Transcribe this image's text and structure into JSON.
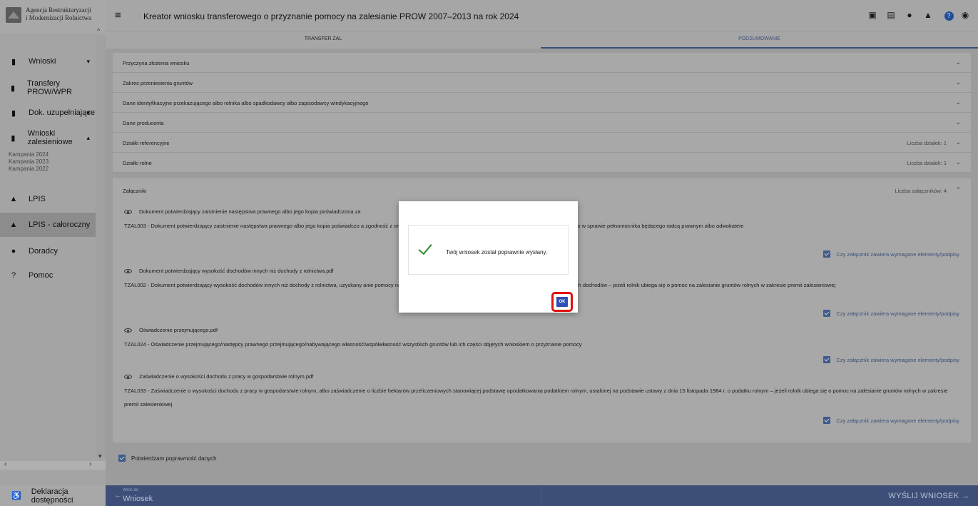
{
  "logo": {
    "line1": "Agencja Restrukturyzacji",
    "line2": "i Modernizacji Rolnictwa"
  },
  "sidebar": {
    "items": [
      {
        "label": "Wnioski",
        "icon": "clipboard-icon",
        "chevron": "down"
      },
      {
        "label": "Transfery PROW/WPR",
        "icon": "clipboard-icon"
      },
      {
        "label": "Dok. uzupełniające",
        "icon": "clipboard-icon",
        "chevron": "down"
      },
      {
        "label": "Wnioski zalesieniowe",
        "icon": "clipboard-icon",
        "chevron": "up"
      },
      {
        "label": "LPIS",
        "icon": "mountain-icon"
      },
      {
        "label": "LPIS - całoroczny",
        "icon": "mountain-icon",
        "active": true
      },
      {
        "label": "Doradcy",
        "icon": "person-icon"
      },
      {
        "label": "Pomoc",
        "icon": "help-icon"
      }
    ],
    "campaigns": [
      "Kampania 2024",
      "Kampania 2023",
      "Kampania 2022"
    ],
    "footer": "Deklaracja dostępności"
  },
  "header": {
    "title": "Kreator wniosku transferowego o przyznanie pomocy na zalesianie PROW 2007–2013 na rok 2024",
    "icons": [
      "save-icon",
      "print-icon",
      "alert-icon",
      "bell-icon",
      "help-icon",
      "account-icon"
    ]
  },
  "tabs": [
    {
      "label": "TRANSFER ZAL"
    },
    {
      "label": "PODSUMOWANIE",
      "active": true
    }
  ],
  "sections": [
    {
      "label": "Przyczyna złożenia wniosku",
      "right": ""
    },
    {
      "label": "Zakres przeniesienia gruntów",
      "right": ""
    },
    {
      "label": "Dane identyfikacyjne przekazującego albo rolnika albo spadkodawcy albo zapisodawcy windykacyjnego",
      "right": ""
    },
    {
      "label": "Dane producenta",
      "right": ""
    },
    {
      "label": "Działki referencyjne",
      "right": "Liczba działek: 1"
    },
    {
      "label": "Działki rolne",
      "right": "Liczba działek: 1"
    }
  ],
  "attachments": {
    "title": "Załączniki",
    "count_label": "Liczba załączników: 4",
    "check_label": "Czy załącznik zawiera wymagane elementy/podpisy",
    "items": [
      {
        "name": "Dokument potwierdzający zaistnienie następstwa prawnego albo jego kopia poświadczona za",
        "desc": "TZAL003 - Dokument potwierdzający zaistnienie następstwa prawnego albo jego kopia poświadczo                                                                                                  a zgodność z oryginałem przez upoważnionego pracownika ARiMR lub przez występującego w sprawie pełnomocnika będącego radcą prawnym albo adwokatem"
      },
      {
        "name": "Dokument potwierdzający wysokość dochodów innych niż dochody z rolnictwa.pdf",
        "desc": "TZAL002 - Dokument potwierdzający wysokość dochodów innych niż dochody z rolnictwa, uzyskany                                                                                                  anie pomocy na zalesianie, albo zaświadczenie naczelnika urzędu skarbowego o braku tych dochodów – jeżeli rolnik ubiega się o pomoc na zalesianie gruntów rolnych w zakresie premii zalesieniowej"
      },
      {
        "name": "Oświadczenie przejmującego.pdf",
        "desc": "TZAL024 - Oświadczenie przejmującego/następcy prawnego przejmującego/nabywającego własność/współwłasność wszystkich gruntów lub ich części objętych wnioskiem o przyznanie pomocy"
      },
      {
        "name": "Zaświadczenie o wysokości dochodu z pracy w gospodarstwie rolnym.pdf",
        "desc": "TZAL033 - Zaświadczenie o wysokości dochodu z pracy w gospodarstwie rolnym, albo zaświadczenie o liczbie hektarów przeliczeniowych stanowiącej podstawę opodatkowania podatkiem rolnym, ustalonej na podstawie ustawy z dnia 15 listopada 1984 r. o podatku rolnym – jeżeli rolnik ubiega się o pomoc na zalesianie gruntów rolnych w zakresie premii zalesieniowej"
      }
    ]
  },
  "confirm_label": "Potwierdzam poprawność danych",
  "bottom": {
    "back_small": "Wróć do",
    "back_big": "Wniosek",
    "send": "WYŚLIJ WNIOSEK"
  },
  "modal": {
    "message": "Twój wniosek został poprawnie wysłany.",
    "ok": "OK"
  },
  "colors": {
    "primary": "#2f4fb8",
    "success": "#2e8b2e",
    "highlight": "#e01010"
  }
}
